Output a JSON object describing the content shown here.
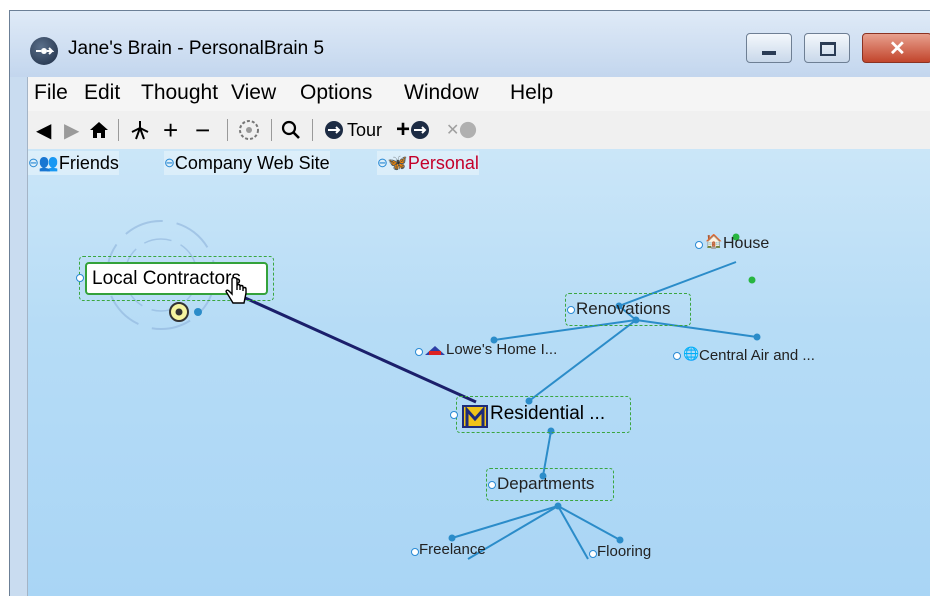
{
  "window": {
    "title": "Jane's Brain - PersonalBrain 5"
  },
  "menu": [
    "File",
    "Edit",
    "Thought",
    "View",
    "Options",
    "Window",
    "Help"
  ],
  "toolbar": {
    "tour_label": "Tour"
  },
  "pins": {
    "friends": "Friends",
    "company": "Company Web Site",
    "personal": "Personal"
  },
  "nodes": {
    "active": "Local Contractors",
    "house": "House",
    "renovations": "Renovations",
    "lowes": "Lowe's Home I...",
    "central_air": "Central Air and ...",
    "residential": "Residential ...",
    "departments": "Departments",
    "freelance": "Freelance",
    "flooring": "Flooring"
  },
  "colors": {
    "accent_green": "#34a23b",
    "link_blue": "#2b8cc9",
    "dark_link": "#1b1f6b",
    "personal_red": "#c4002a"
  }
}
